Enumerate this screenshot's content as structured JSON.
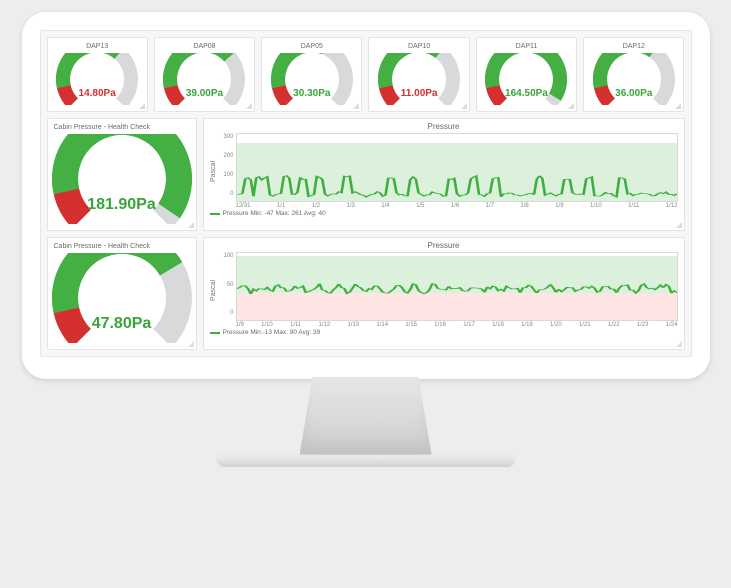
{
  "small_gauges": [
    {
      "label": "DAP13",
      "value": "14.80Pa",
      "percent": 0.65,
      "status": "low"
    },
    {
      "label": "DAP08",
      "value": "39.00Pa",
      "percent": 0.68,
      "status": "ok"
    },
    {
      "label": "DAP05",
      "value": "30.30Pa",
      "percent": 0.58,
      "status": "ok"
    },
    {
      "label": "DAP10",
      "value": "11.00Pa",
      "percent": 0.64,
      "status": "low"
    },
    {
      "label": "DAP11",
      "value": "164.50Pa",
      "percent": 0.95,
      "status": "ok"
    },
    {
      "label": "DAP12",
      "value": "36.00Pa",
      "percent": 0.63,
      "status": "ok"
    }
  ],
  "big_panels": [
    {
      "title": "Cabin Pressure - Health Check",
      "value": "181.90Pa",
      "percent": 0.96,
      "status": "ok"
    },
    {
      "title": "Cabin Pressure - Health Check",
      "value": "47.80Pa",
      "percent": 0.72,
      "status": "ok"
    }
  ],
  "charts": [
    {
      "title": "Pressure",
      "ylabel": "Pascal",
      "yticks": [
        "300",
        "200",
        "100",
        "0"
      ],
      "xticks": [
        "12/31",
        "1/1",
        "1/2",
        "1/3",
        "1/4",
        "1/5",
        "1/6",
        "1/7",
        "1/8",
        "1/9",
        "1/10",
        "1/11",
        "1/12"
      ],
      "legend": "Pressure  Min: -47  Max: 261  Avg: 40",
      "zone_green": {
        "top": 13,
        "bottom": 100
      },
      "zone_red": null
    },
    {
      "title": "Pressure",
      "ylabel": "Pascal",
      "yticks": [
        "100",
        "50",
        "0"
      ],
      "xticks": [
        "1/9",
        "1/10",
        "1/11",
        "1/12",
        "1/13",
        "1/14",
        "1/15",
        "1/16",
        "1/17",
        "1/18",
        "1/19",
        "1/20",
        "1/21",
        "1/22",
        "1/23",
        "1/24"
      ],
      "legend": "Pressure  Min:-13  Max: 90  Avg: 39",
      "zone_green": {
        "top": 5,
        "bottom": 60
      },
      "zone_red": {
        "top": 60,
        "bottom": 100
      }
    }
  ],
  "chart_data": [
    {
      "type": "line",
      "title": "Pressure",
      "ylabel": "Pascal",
      "ylim": [
        0,
        300
      ],
      "x": [
        "12/31",
        "1/1",
        "1/2",
        "1/3",
        "1/4",
        "1/5",
        "1/6",
        "1/7",
        "1/8",
        "1/9",
        "1/10",
        "1/11",
        "1/12"
      ],
      "series": [
        {
          "name": "Pressure",
          "min": -47,
          "max": 261,
          "avg": 40
        }
      ],
      "zones": [
        {
          "type": "ok",
          "from": 0,
          "to": 260
        }
      ]
    },
    {
      "type": "line",
      "title": "Pressure",
      "ylabel": "Pascal",
      "ylim": [
        0,
        100
      ],
      "x": [
        "1/9",
        "1/10",
        "1/11",
        "1/12",
        "1/13",
        "1/14",
        "1/15",
        "1/16",
        "1/17",
        "1/18",
        "1/19",
        "1/20",
        "1/21",
        "1/22",
        "1/23",
        "1/24"
      ],
      "series": [
        {
          "name": "Pressure",
          "min": -13,
          "max": 90,
          "avg": 39
        }
      ],
      "zones": [
        {
          "type": "ok",
          "from": 40,
          "to": 95
        },
        {
          "type": "bad",
          "from": 0,
          "to": 40
        }
      ]
    }
  ]
}
